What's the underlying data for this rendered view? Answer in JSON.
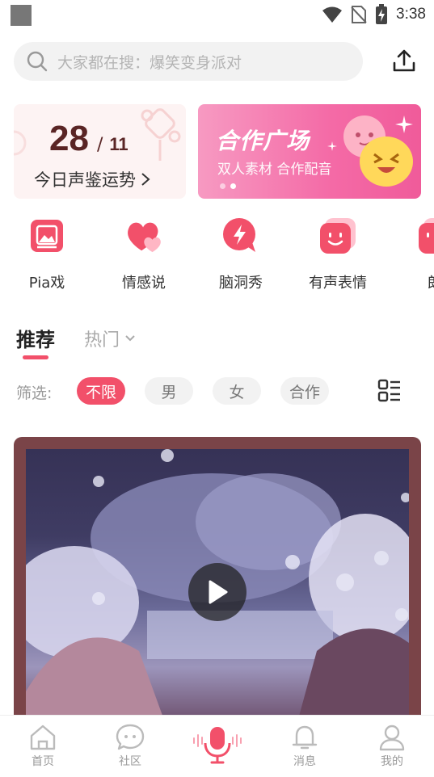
{
  "status_bar": {
    "time": "3:38"
  },
  "search": {
    "placeholder": "大家都在搜：爆笑变身派对"
  },
  "fortune": {
    "day": "28",
    "separator": "/",
    "month": "11",
    "label": "今日声鉴运势"
  },
  "coop_banner": {
    "title": "合作广场",
    "subtitle": "双人素材 合作配音"
  },
  "categories": [
    {
      "label": "Pia戏",
      "icon": "image-frame-icon"
    },
    {
      "label": "情感说",
      "icon": "hearts-icon"
    },
    {
      "label": "脑洞秀",
      "icon": "lightning-bubble-icon"
    },
    {
      "label": "有声表情",
      "icon": "smile-face-icon"
    },
    {
      "label": "朗",
      "icon": "reading-icon"
    }
  ],
  "tabs": {
    "recommend": "推荐",
    "hot": "热门"
  },
  "filter": {
    "label": "筛选:",
    "options": [
      "不限",
      "男",
      "女",
      "合作"
    ],
    "selected": "不限"
  },
  "bottom_nav": {
    "home": "首页",
    "community": "社区",
    "messages": "消息",
    "mine": "我的"
  },
  "colors": {
    "accent": "#f2506a",
    "coop_pink": "#f46aa6"
  }
}
